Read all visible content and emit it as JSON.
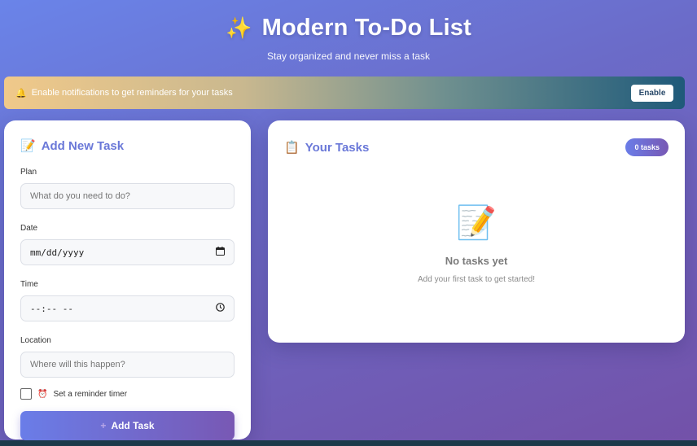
{
  "header": {
    "title": "Modern To-Do List",
    "subtitle": "Stay organized and never miss a task"
  },
  "notification": {
    "text": "Enable notifications to get reminders for your tasks",
    "button_label": "Enable"
  },
  "add_task": {
    "title": "Add New Task",
    "plan_label": "Plan",
    "plan_placeholder": "What do you need to do?",
    "date_label": "Date",
    "date_value": "mm/dd/yyyy",
    "time_label": "Time",
    "time_value": "--:-- --",
    "location_label": "Location",
    "location_placeholder": "Where will this happen?",
    "reminder_label": "Set a reminder timer",
    "reminder_checked": false,
    "button_label": "Add Task"
  },
  "tasks": {
    "title": "Your Tasks",
    "count_label": "0 tasks",
    "empty_title": "No tasks yet",
    "empty_subtitle": "Add your first task to get started!"
  },
  "icons": {
    "title_icon": "sparkles-icon",
    "notification_icon": "bell-icon",
    "add_task_icon": "memo-icon",
    "tasks_icon": "clipboard-icon",
    "empty_icon": "document-pencil-icon",
    "reminder_icon": "alarm-clock-icon",
    "calendar_icon": "calendar-icon",
    "clock_icon": "clock-icon",
    "add_icon": "plus-icon"
  },
  "colors": {
    "accent": "#6a78d8",
    "gradient_start": "#6a7de8",
    "gradient_end": "#7858b4"
  }
}
